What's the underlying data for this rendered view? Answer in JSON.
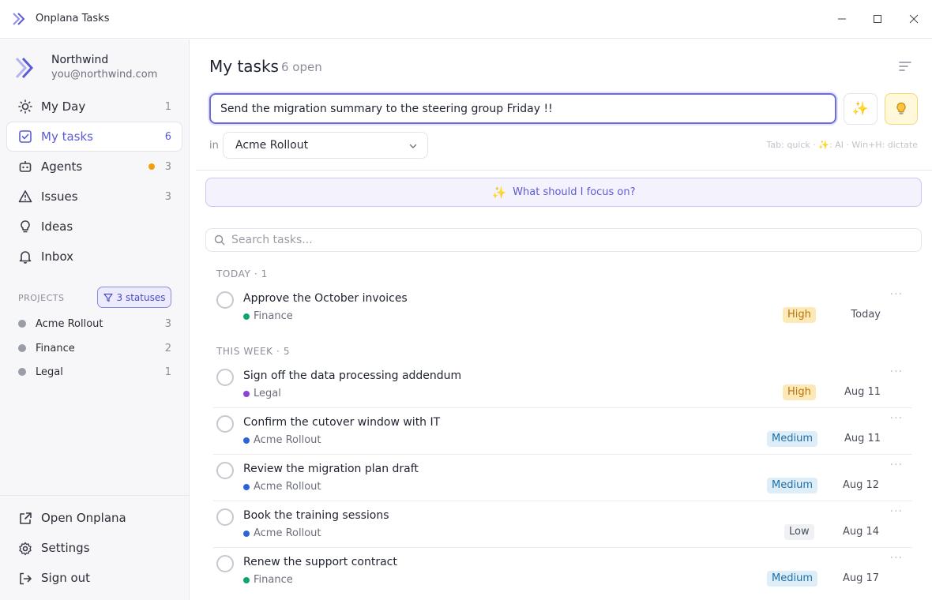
{
  "window": {
    "title": "Onplana Tasks"
  },
  "profile": {
    "name": "Northwind",
    "email": "you@northwind.com"
  },
  "nav": [
    {
      "label": "My Day",
      "count": "1",
      "icon": "sun-icon"
    },
    {
      "label": "My tasks",
      "count": "6",
      "icon": "checkbox-icon",
      "active": true
    },
    {
      "label": "Agents",
      "count": "3",
      "icon": "robot-icon",
      "dot_color": "#f59e0b"
    },
    {
      "label": "Issues",
      "count": "3",
      "icon": "warning-icon"
    },
    {
      "label": "Ideas",
      "count": "",
      "icon": "lightbulb-icon"
    },
    {
      "label": "Inbox",
      "count": "",
      "icon": "bell-icon"
    }
  ],
  "projects": {
    "label": "PROJECTS",
    "filter_label": "3 statuses",
    "items": [
      {
        "name": "Acme Rollout",
        "count": "3"
      },
      {
        "name": "Finance",
        "count": "2"
      },
      {
        "name": "Legal",
        "count": "1"
      }
    ]
  },
  "footer": {
    "open_label": "Open Onplana",
    "settings_label": "Settings",
    "signout_label": "Sign out"
  },
  "main": {
    "title": "My tasks",
    "open_count": "6 open",
    "task_input_value": "Send the migration summary to the steering group Friday !!",
    "ai_button_icon": "sparkles-icon",
    "idea_button_icon": "lightbulb-icon",
    "in_label": "in",
    "selected_project": "Acme Rollout",
    "shortcut_hint": "Tab: quick · ✨: AI · Win+H: dictate",
    "focus_label": "What should I focus on?",
    "search_placeholder": "Search tasks..."
  },
  "groups": [
    {
      "header": "TODAY · 1",
      "tasks": [
        {
          "title": "Approve the October invoices",
          "project": "Finance",
          "project_color": "#10a36a",
          "priority": "High",
          "date": "Today"
        }
      ]
    },
    {
      "header": "THIS WEEK · 5",
      "tasks": [
        {
          "title": "Sign off the data processing addendum",
          "project": "Legal",
          "project_color": "#8b45d9",
          "priority": "High",
          "date": "Aug 11"
        },
        {
          "title": "Confirm the cutover window with IT",
          "project": "Acme Rollout",
          "project_color": "#2f62d6",
          "priority": "Medium",
          "date": "Aug 11"
        },
        {
          "title": "Review the migration plan draft",
          "project": "Acme Rollout",
          "project_color": "#2f62d6",
          "priority": "Medium",
          "date": "Aug 12"
        },
        {
          "title": "Book the training sessions",
          "project": "Acme Rollout",
          "project_color": "#2f62d6",
          "priority": "Low",
          "date": "Aug 14"
        },
        {
          "title": "Renew the support contract",
          "project": "Finance",
          "project_color": "#10a36a",
          "priority": "Medium",
          "date": "Aug 17"
        }
      ]
    }
  ],
  "colors": {
    "accent": "#5b5bd6",
    "high": "#b8730a",
    "medium": "#1e6fa8"
  }
}
